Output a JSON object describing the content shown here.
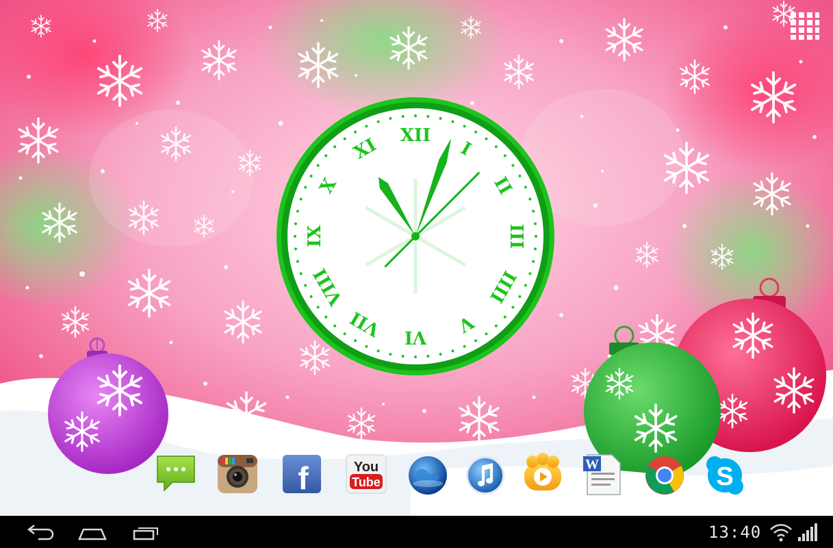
{
  "clock": {
    "numerals": [
      "XII",
      "I",
      "II",
      "III",
      "IIII",
      "V",
      "VI",
      "VII",
      "VIII",
      "IX",
      "X",
      "XI"
    ],
    "accent_color": "#1cc41c"
  },
  "dock": {
    "apps": [
      {
        "name": "Messaging",
        "icon": "message-icon"
      },
      {
        "name": "Instagram",
        "icon": "camera-icon"
      },
      {
        "name": "Facebook",
        "icon": "facebook-icon",
        "glyph": "f"
      },
      {
        "name": "YouTube",
        "icon": "youtube-icon",
        "text_top": "You",
        "text_bottom": "Tube"
      },
      {
        "name": "Browser",
        "icon": "globe-icon"
      },
      {
        "name": "Music",
        "icon": "music-note-icon"
      },
      {
        "name": "Video Player",
        "icon": "video-player-icon"
      },
      {
        "name": "Word",
        "icon": "word-document-icon",
        "glyph": "W"
      },
      {
        "name": "Chrome",
        "icon": "chrome-icon"
      },
      {
        "name": "Skype",
        "icon": "skype-icon",
        "glyph": "S"
      }
    ]
  },
  "navbar": {
    "back": "back-icon",
    "home": "home-icon",
    "recents": "recents-icon"
  },
  "status": {
    "time": "13:40",
    "wifi": "wifi-icon",
    "signal": "signal-icon"
  },
  "apps_button": "apps-grid-icon"
}
